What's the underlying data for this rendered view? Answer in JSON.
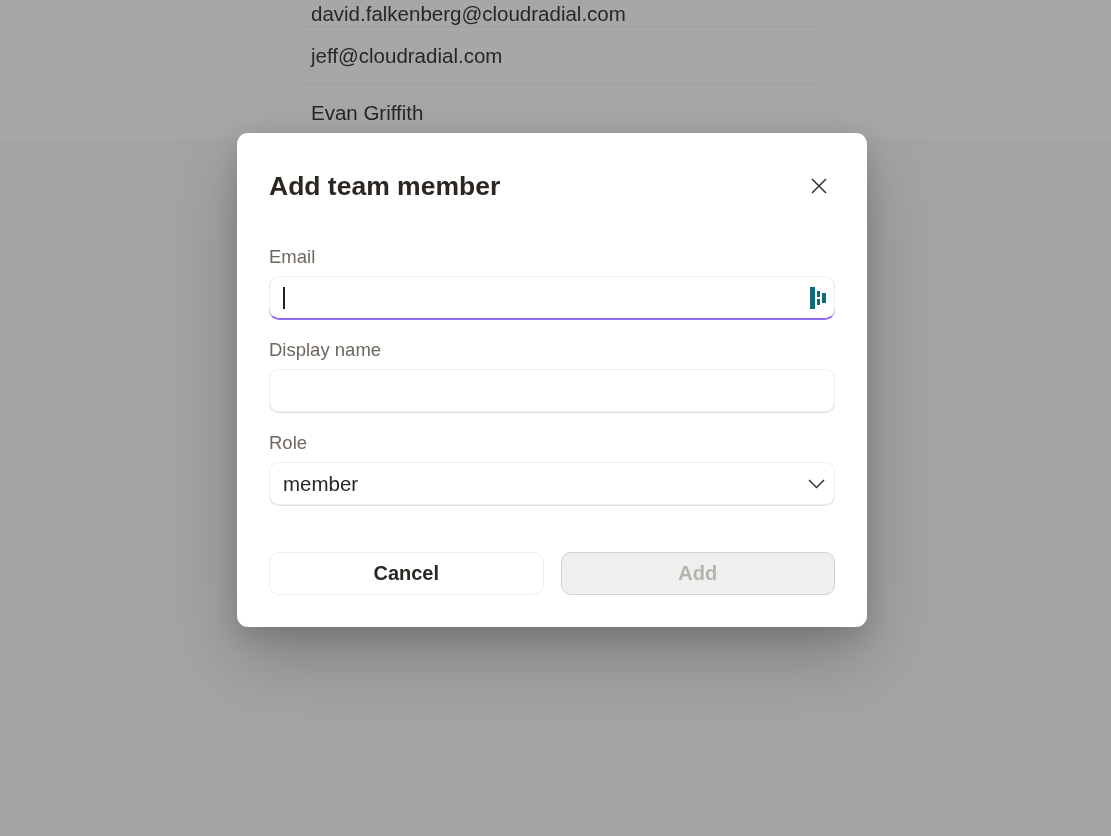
{
  "background_list": {
    "items": [
      "david.falkenberg@cloudradial.com",
      "jeff@cloudradial.com",
      "Evan Griffith"
    ]
  },
  "dialog": {
    "title": "Add team member",
    "fields": [
      {
        "kind": "email",
        "label": "Email",
        "focused": true
      },
      {
        "kind": "text",
        "label": "Display name",
        "focused": false
      },
      {
        "kind": "select",
        "label": "Role",
        "value": "member"
      }
    ],
    "buttons": [
      {
        "label": "Cancel",
        "kind": "secondary",
        "disabled": false
      },
      {
        "label": "Add",
        "kind": "primary",
        "disabled": true
      }
    ]
  }
}
